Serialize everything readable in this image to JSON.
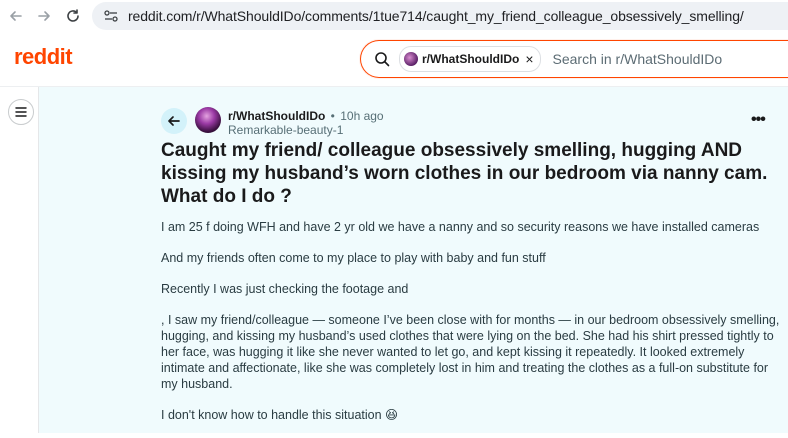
{
  "browser": {
    "url": "reddit.com/r/WhatShouldIDo/comments/1tue714/caught_my_friend_colleague_obsessively_smelling/"
  },
  "header": {
    "logo": "reddit",
    "search": {
      "chip_label": "r/WhatShouldIDo",
      "chip_close": "×",
      "placeholder": "Search in r/WhatShouldIDo"
    }
  },
  "post": {
    "subreddit": "r/WhatShouldIDo",
    "separator": "•",
    "time": "10h ago",
    "author": "Remarkable-beauty-1",
    "more": "•••",
    "title": "Caught my friend/ colleague obsessively smelling, hugging AND kissing my husband’s worn clothes in our bedroom via nanny cam. What do I do ?",
    "paragraphs": [
      "I am 25 f doing WFH and have 2 yr old we have a nanny and so security reasons we have installed cameras",
      "And my friends often come to my place to play with baby and fun stuff",
      "Recently I was just checking the footage and",
      ", I saw my friend/colleague — someone I’ve been close with for months — in our bedroom obsessively smelling, hugging, and kissing my husband’s used clothes that were lying on the bed. She had his shirt pressed tightly to her face, was hugging it like she never wanted to let go, and kept kissing it repeatedly. It looked extremely intimate and affectionate, like she was completely lost in him and treating the clothes as a full-on substitute for my husband.",
      "I don't know how to handle this situation 😆"
    ]
  }
}
